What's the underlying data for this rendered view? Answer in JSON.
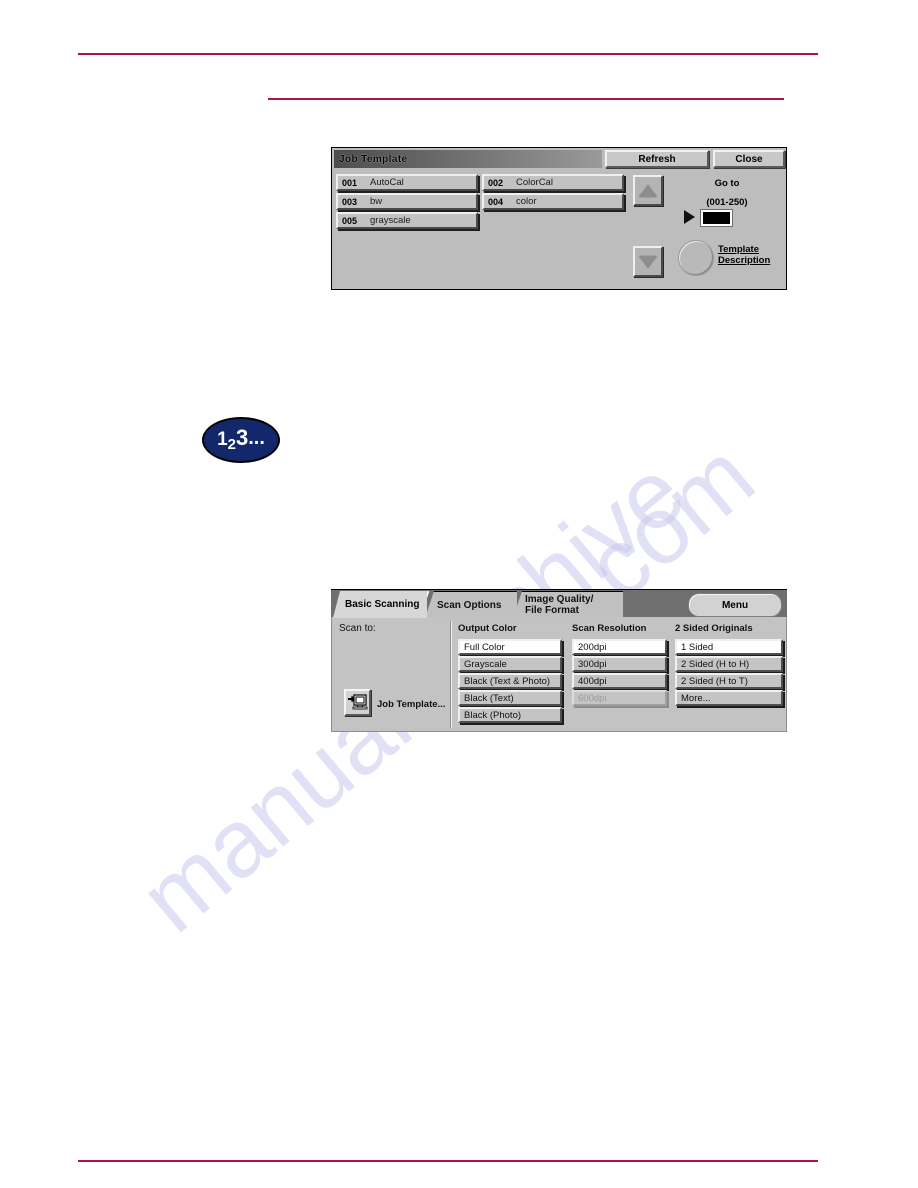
{
  "watermark": {
    "line1": "manualsarchive",
    "line2": ".com"
  },
  "step_badge": {
    "digit1": "1",
    "digit2": "2",
    "digit3": "3",
    "ellipsis": "..."
  },
  "job_template_panel": {
    "title": "Job Template",
    "refresh_label": "Refresh",
    "close_label": "Close",
    "templates": [
      {
        "number": "001",
        "name": "AutoCal"
      },
      {
        "number": "002",
        "name": "ColorCal"
      },
      {
        "number": "003",
        "name": "bw"
      },
      {
        "number": "004",
        "name": "color"
      },
      {
        "number": "005",
        "name": "grayscale"
      }
    ],
    "goto_label": "Go to",
    "goto_range": "(001-250)",
    "goto_value": "",
    "template_description_line1": "Template",
    "template_description_line2": "Description"
  },
  "scan_panel": {
    "tabs": [
      {
        "label": "Basic Scanning",
        "active": true
      },
      {
        "label": "Scan Options",
        "active": false
      },
      {
        "label_line1": "Image Quality/",
        "label_line2": "File Format",
        "active": false
      }
    ],
    "menu_label": "Menu",
    "scan_to_label": "Scan to:",
    "job_template_button_label": "Job Template...",
    "columns": [
      {
        "header": "Output Color",
        "options": [
          {
            "label": "Full Color",
            "selected": true,
            "disabled": false
          },
          {
            "label": "Grayscale",
            "selected": false,
            "disabled": false
          },
          {
            "label": "Black (Text & Photo)",
            "selected": false,
            "disabled": false
          },
          {
            "label": "Black (Text)",
            "selected": false,
            "disabled": false
          },
          {
            "label": "Black (Photo)",
            "selected": false,
            "disabled": false
          }
        ]
      },
      {
        "header": "Scan Resolution",
        "options": [
          {
            "label": "200dpi",
            "selected": true,
            "disabled": false
          },
          {
            "label": "300dpi",
            "selected": false,
            "disabled": false
          },
          {
            "label": "400dpi",
            "selected": false,
            "disabled": false
          },
          {
            "label": "600dpi",
            "selected": false,
            "disabled": true
          }
        ]
      },
      {
        "header": "2 Sided Originals",
        "options": [
          {
            "label": "1 Sided",
            "selected": true,
            "disabled": false
          },
          {
            "label": "2 Sided (H to H)",
            "selected": false,
            "disabled": false
          },
          {
            "label": "2 Sided (H to T)",
            "selected": false,
            "disabled": false
          },
          {
            "label": "More...",
            "selected": false,
            "disabled": false
          }
        ]
      }
    ]
  },
  "colors": {
    "rule": "#b1114b",
    "badge": "#13276b",
    "panel_bg": "#bdbdbd",
    "watermark": "#c9c9ee"
  }
}
